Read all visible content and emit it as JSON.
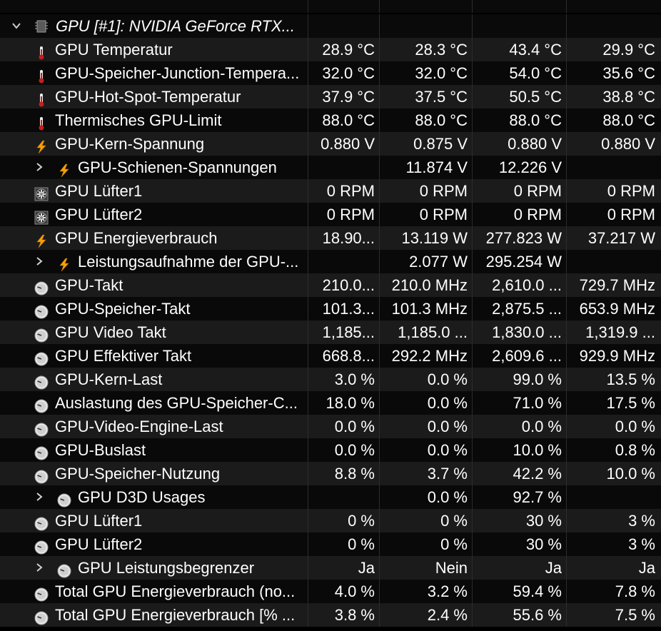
{
  "header": {
    "title": "GPU [#1]: NVIDIA GeForce RTX..."
  },
  "rows": [
    {
      "label": "GPU Temperatur",
      "icon": "thermometer-icon",
      "indent": false,
      "values": [
        "28.9 °C",
        "28.3 °C",
        "43.4 °C",
        "29.9 °C"
      ]
    },
    {
      "label": "GPU-Speicher-Junction-Tempera...",
      "icon": "thermometer-icon",
      "indent": false,
      "values": [
        "32.0 °C",
        "32.0 °C",
        "54.0 °C",
        "35.6 °C"
      ]
    },
    {
      "label": "GPU-Hot-Spot-Temperatur",
      "icon": "thermometer-icon",
      "indent": false,
      "values": [
        "37.9 °C",
        "37.5 °C",
        "50.5 °C",
        "38.8 °C"
      ]
    },
    {
      "label": "Thermisches GPU-Limit",
      "icon": "thermometer-icon",
      "indent": false,
      "values": [
        "88.0 °C",
        "88.0 °C",
        "88.0 °C",
        "88.0 °C"
      ]
    },
    {
      "label": "GPU-Kern-Spannung",
      "icon": "lightning-icon",
      "indent": false,
      "values": [
        "0.880 V",
        "0.875 V",
        "0.880 V",
        "0.880 V"
      ]
    },
    {
      "label": "GPU-Schienen-Spannungen",
      "icon": "lightning-icon",
      "indent": true,
      "values": [
        "",
        "11.874 V",
        "12.226 V",
        ""
      ]
    },
    {
      "label": "GPU Lüfter1",
      "icon": "fan-icon",
      "indent": false,
      "values": [
        "0 RPM",
        "0 RPM",
        "0 RPM",
        "0 RPM"
      ]
    },
    {
      "label": "GPU Lüfter2",
      "icon": "fan-icon",
      "indent": false,
      "values": [
        "0 RPM",
        "0 RPM",
        "0 RPM",
        "0 RPM"
      ]
    },
    {
      "label": "GPU Energieverbrauch",
      "icon": "lightning-icon",
      "indent": false,
      "values": [
        "18.90...",
        "13.119 W",
        "277.823 W",
        "37.217 W"
      ]
    },
    {
      "label": "Leistungsaufnahme der GPU-...",
      "icon": "lightning-icon",
      "indent": true,
      "values": [
        "",
        "2.077 W",
        "295.254 W",
        ""
      ]
    },
    {
      "label": "GPU-Takt",
      "icon": "clock-icon",
      "indent": false,
      "values": [
        "210.0...",
        "210.0 MHz",
        "2,610.0 ...",
        "729.7 MHz"
      ]
    },
    {
      "label": "GPU-Speicher-Takt",
      "icon": "clock-icon",
      "indent": false,
      "values": [
        "101.3...",
        "101.3 MHz",
        "2,875.5 ...",
        "653.9 MHz"
      ]
    },
    {
      "label": "GPU Video Takt",
      "icon": "clock-icon",
      "indent": false,
      "values": [
        "1,185...",
        "1,185.0 ...",
        "1,830.0 ...",
        "1,319.9 ..."
      ]
    },
    {
      "label": "GPU Effektiver Takt",
      "icon": "clock-icon",
      "indent": false,
      "values": [
        "668.8...",
        "292.2 MHz",
        "2,609.6 ...",
        "929.9 MHz"
      ]
    },
    {
      "label": "GPU-Kern-Last",
      "icon": "clock-icon",
      "indent": false,
      "values": [
        "3.0 %",
        "0.0 %",
        "99.0 %",
        "13.5 %"
      ]
    },
    {
      "label": "Auslastung des GPU-Speicher-C...",
      "icon": "clock-icon",
      "indent": false,
      "values": [
        "18.0 %",
        "0.0 %",
        "71.0 %",
        "17.5 %"
      ]
    },
    {
      "label": "GPU-Video-Engine-Last",
      "icon": "clock-icon",
      "indent": false,
      "values": [
        "0.0 %",
        "0.0 %",
        "0.0 %",
        "0.0 %"
      ]
    },
    {
      "label": "GPU-Buslast",
      "icon": "clock-icon",
      "indent": false,
      "values": [
        "0.0 %",
        "0.0 %",
        "10.0 %",
        "0.8 %"
      ]
    },
    {
      "label": "GPU-Speicher-Nutzung",
      "icon": "clock-icon",
      "indent": false,
      "values": [
        "8.8 %",
        "3.7 %",
        "42.2 %",
        "10.0 %"
      ]
    },
    {
      "label": "GPU D3D Usages",
      "icon": "clock-icon",
      "indent": true,
      "values": [
        "",
        "0.0 %",
        "92.7 %",
        ""
      ]
    },
    {
      "label": "GPU Lüfter1",
      "icon": "clock-icon",
      "indent": false,
      "values": [
        "0 %",
        "0 %",
        "30 %",
        "3 %"
      ]
    },
    {
      "label": "GPU Lüfter2",
      "icon": "clock-icon",
      "indent": false,
      "values": [
        "0 %",
        "0 %",
        "30 %",
        "3 %"
      ]
    },
    {
      "label": "GPU Leistungsbegrenzer",
      "icon": "clock-icon",
      "indent": true,
      "values": [
        "Ja",
        "Nein",
        "Ja",
        "Ja"
      ]
    },
    {
      "label": "Total GPU Energieverbrauch (no...",
      "icon": "clock-icon",
      "indent": false,
      "values": [
        "4.0 %",
        "3.2 %",
        "59.4 %",
        "7.8 %"
      ]
    },
    {
      "label": "Total GPU Energieverbrauch [% ...",
      "icon": "clock-icon",
      "indent": false,
      "values": [
        "3.8 %",
        "2.4 %",
        "55.6 %",
        "7.5 %"
      ]
    }
  ],
  "colors": {
    "thermometer": "#c41f1f",
    "lightning": "#f5a10a",
    "clock": "#d8d8d8",
    "row_odd": "#1b1b1b",
    "row_even": "#090909"
  }
}
